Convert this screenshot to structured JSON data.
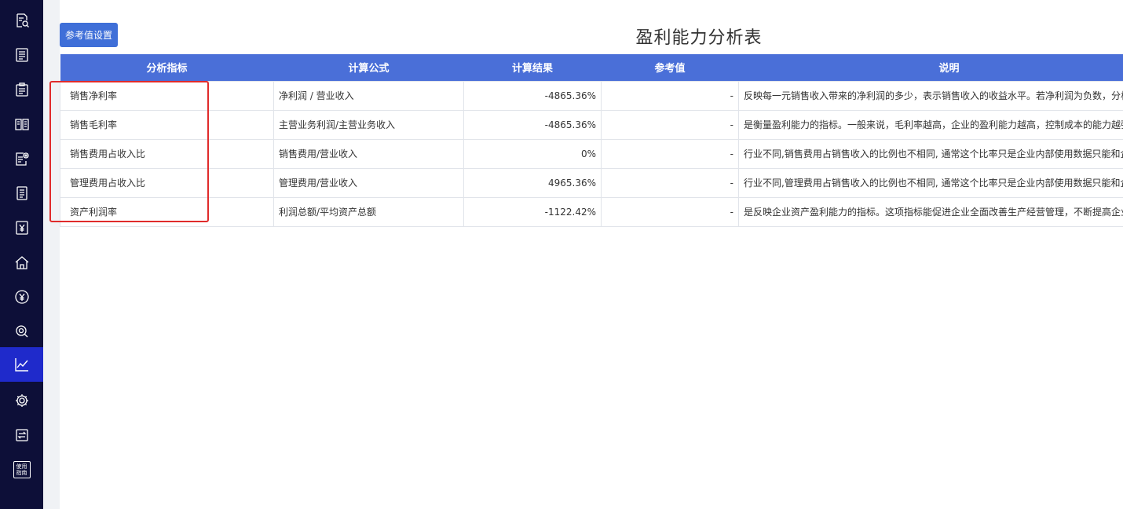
{
  "sidebar": {
    "items": [
      {
        "icon": "document-search-icon",
        "active": false
      },
      {
        "icon": "list-document-icon",
        "active": false
      },
      {
        "icon": "clipboard-icon",
        "active": false
      },
      {
        "icon": "book-icon",
        "active": false
      },
      {
        "icon": "document-settings-icon",
        "active": false
      },
      {
        "icon": "notes-icon",
        "active": false
      },
      {
        "icon": "yen-document-icon",
        "active": false
      },
      {
        "icon": "building-icon",
        "active": false
      },
      {
        "icon": "yen-circle-icon",
        "active": false
      },
      {
        "icon": "coin-search-icon",
        "active": false
      },
      {
        "icon": "line-chart-icon",
        "active": true
      },
      {
        "icon": "gear-icon",
        "active": false
      },
      {
        "icon": "transfer-icon",
        "active": false
      },
      {
        "icon": "guide-icon",
        "active": false,
        "label_line1": "使用",
        "label_line2": "指南"
      }
    ]
  },
  "toolbar": {
    "ref_button_label": "参考值设置"
  },
  "page": {
    "title": "盈利能力分析表"
  },
  "table": {
    "headers": [
      "分析指标",
      "计算公式",
      "计算结果",
      "参考值",
      "说明"
    ],
    "rows": [
      {
        "indicator": "销售净利率",
        "formula": "净利润 / 营业收入",
        "result": "-4865.36%",
        "reference": "-",
        "description": "反映每一元销售收入带来的净利润的多少，表示销售收入的收益水平。若净利润为负数，分析"
      },
      {
        "indicator": "销售毛利率",
        "formula": "主营业务利润/主营业务收入",
        "result": "-4865.36%",
        "reference": "-",
        "description": "是衡量盈利能力的指标。一般来说，毛利率越高，企业的盈利能力越高，控制成本的能力越强"
      },
      {
        "indicator": "销售费用占收入比",
        "formula": "销售费用/营业收入",
        "result": "0%",
        "reference": "-",
        "description": "行业不同,销售费用占销售收入的比例也不相同, 通常这个比率只是企业内部使用数据只能和企"
      },
      {
        "indicator": "管理费用占收入比",
        "formula": "管理费用/营业收入",
        "result": "4965.36%",
        "reference": "-",
        "description": "行业不同,管理费用占销售收入的比例也不相同, 通常这个比率只是企业内部使用数据只能和企"
      },
      {
        "indicator": "资产利润率",
        "formula": "利润总额/平均资产总额",
        "result": "-1122.42%",
        "reference": "-",
        "description": "是反映企业资产盈利能力的指标。这项指标能促进企业全面改善生产经营管理，不断提高企业"
      }
    ]
  },
  "colors": {
    "sidebar_bg": "#0d0f38",
    "active_item": "#1f2acb",
    "header_bg": "#4a6fd8",
    "button_bg": "#3f6fd8",
    "highlight": "#e02b2b"
  }
}
